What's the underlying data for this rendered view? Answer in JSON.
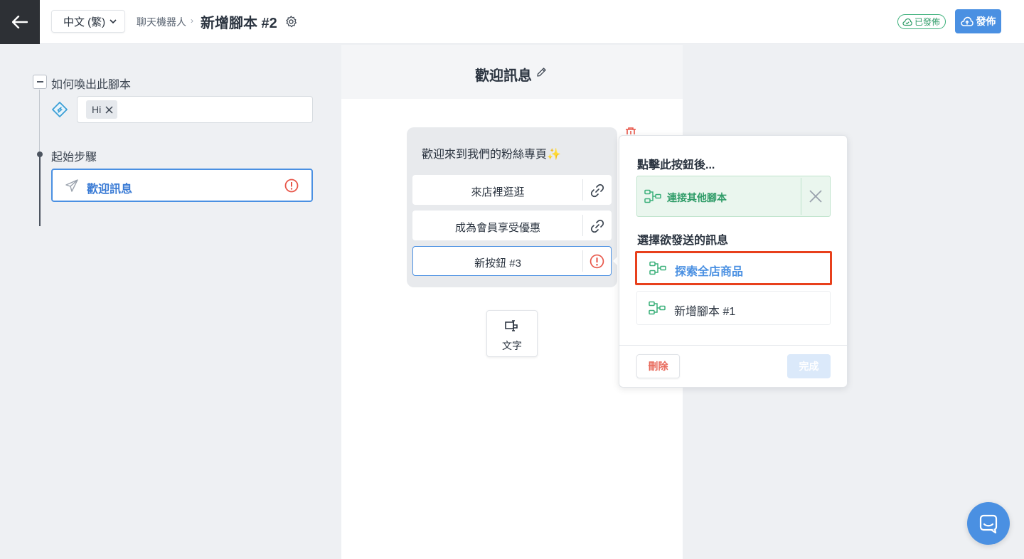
{
  "header": {
    "language": "中文 (繁)",
    "breadcrumb": "聊天機器人",
    "title": "新增腳本 #2",
    "status_badge": "已發佈",
    "publish_label": "發佈"
  },
  "sidebar": {
    "trigger_section": "如何喚出此腳本",
    "keywords": [
      "Hi"
    ],
    "start_section": "起始步驟",
    "step_label": "歡迎訊息"
  },
  "canvas": {
    "title": "歡迎訊息",
    "message_text": "歡迎來到我們的粉絲專頁✨",
    "buttons": [
      {
        "label": "來店裡逛逛",
        "icon": "link-icon"
      },
      {
        "label": "成為會員享受優惠",
        "icon": "link-icon"
      },
      {
        "label": "新按鈕 #3",
        "icon": "warning-icon"
      }
    ],
    "add_text_label": "文字"
  },
  "popover": {
    "action_heading": "點擊此按鈕後...",
    "connect_label": "連接其他腳本",
    "select_heading": "選擇欲發送的訊息",
    "options": [
      "探索全店商品",
      "新增腳本 #1"
    ],
    "delete_label": "刪除",
    "done_label": "完成"
  },
  "colors": {
    "accent": "#4a90e2",
    "success": "#2f9c68",
    "danger": "#e8401c",
    "warning": "#e8574a"
  }
}
